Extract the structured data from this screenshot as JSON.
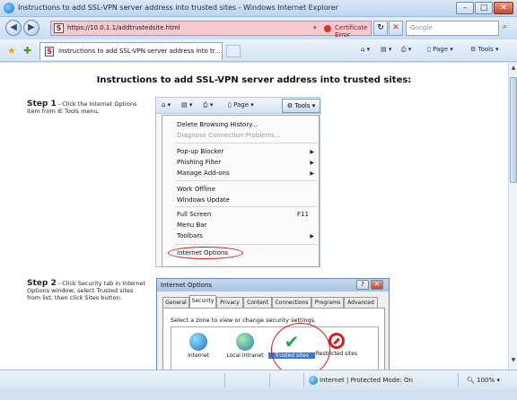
{
  "window": {
    "title": "Instructions to add SSL-VPN server address into trusted sites - Windows Internet Explorer"
  },
  "addressbar": {
    "url": "https://10.0.1.1/addtrustedsite.html",
    "certificate_error": "Certificate Error",
    "search_placeholder": "Google"
  },
  "tab": {
    "label": "Instructions to add SSL-VPN server address into tr...",
    "favicon_letter": "S"
  },
  "commandbar": {
    "page": "Page",
    "tools": "Tools"
  },
  "page": {
    "title": "Instructions to add SSL-VPN server address into trusted sites:",
    "step1": {
      "heading": "Step 1",
      "text": " - Click the Internet Options item from IE Tools menu."
    },
    "step2": {
      "heading": "Step 2",
      "text": " - Click Security tab in Internet Options window, select Trusted sites from list, then click Sites button."
    }
  },
  "tools_menu": {
    "toolbar_page": "Page",
    "toolbar_tools": "Tools",
    "items": [
      {
        "label": "Delete Browsing History...",
        "disabled": false,
        "submenu": false
      },
      {
        "label": "Diagnose Connection Problems...",
        "disabled": true,
        "submenu": false
      },
      {
        "label": "Pop-up Blocker",
        "disabled": false,
        "submenu": true
      },
      {
        "label": "Phishing Filter",
        "disabled": false,
        "submenu": true
      },
      {
        "label": "Manage Add-ons",
        "disabled": false,
        "submenu": true
      },
      {
        "label": "Work Offline",
        "disabled": false,
        "submenu": false
      },
      {
        "label": "Windows Update",
        "disabled": false,
        "submenu": false
      },
      {
        "label": "Full Screen",
        "disabled": false,
        "submenu": false,
        "shortcut": "F11"
      },
      {
        "label": "Menu Bar",
        "disabled": false,
        "submenu": false
      },
      {
        "label": "Toolbars",
        "disabled": false,
        "submenu": true
      },
      {
        "label": "Internet Options",
        "disabled": false,
        "submenu": false
      }
    ]
  },
  "internet_options": {
    "title": "Internet Options",
    "tabs": [
      "General",
      "Security",
      "Privacy",
      "Content",
      "Connections",
      "Programs",
      "Advanced"
    ],
    "active_tab": "Security",
    "zone_prompt": "Select a zone to view or change security settings.",
    "zones": [
      {
        "label": "Internet",
        "icon": "globe-icon"
      },
      {
        "label": "Local intranet",
        "icon": "local-intranet-icon"
      },
      {
        "label": "Trusted sites",
        "icon": "checkmark-icon",
        "selected": true
      },
      {
        "label": "Restricted sites",
        "icon": "restricted-icon"
      }
    ]
  },
  "statusbar": {
    "zone": "Internet | Protected Mode: On",
    "zoom": "100%"
  }
}
